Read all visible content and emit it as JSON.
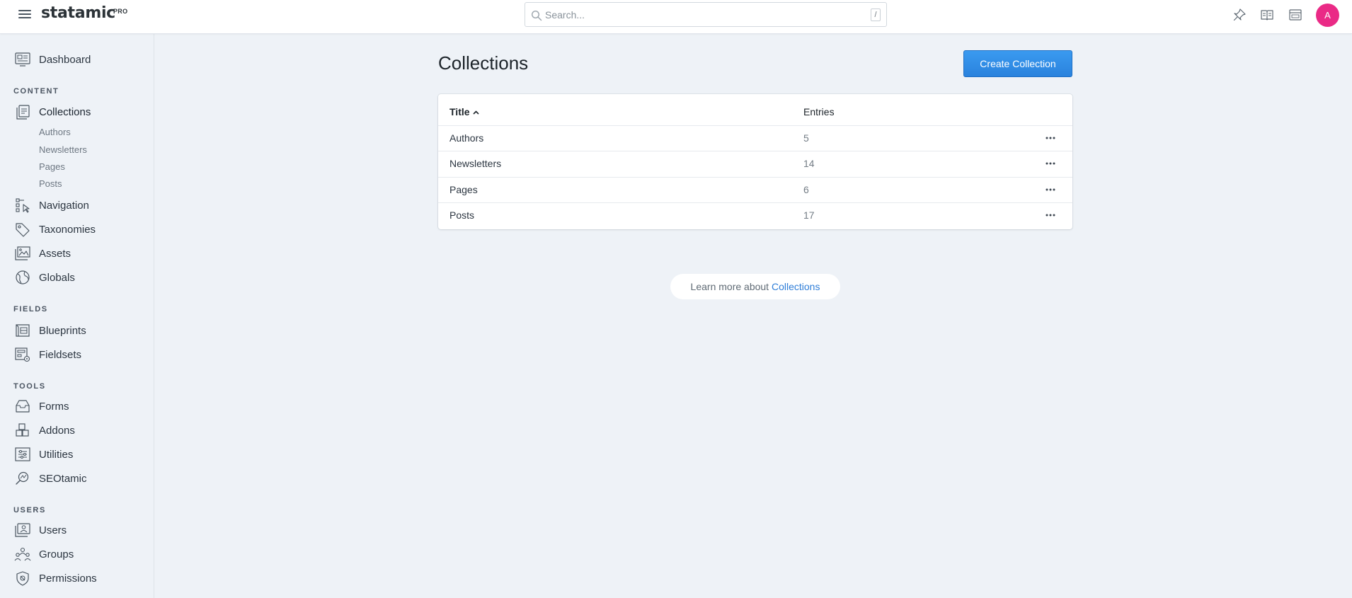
{
  "topbar": {
    "logo": "statamic",
    "logo_badge": "PRO",
    "search_placeholder": "Search...",
    "search_shortcut": "/",
    "avatar_initial": "A",
    "accent": "#ea2a86"
  },
  "sidebar": {
    "dashboard": "Dashboard",
    "sections": {
      "content": "CONTENT",
      "fields": "FIELDS",
      "tools": "TOOLS",
      "users": "USERS"
    },
    "content_items": {
      "collections": "Collections",
      "navigation": "Navigation",
      "taxonomies": "Taxonomies",
      "assets": "Assets",
      "globals": "Globals"
    },
    "collection_children": [
      "Authors",
      "Newsletters",
      "Pages",
      "Posts"
    ],
    "fields_items": {
      "blueprints": "Blueprints",
      "fieldsets": "Fieldsets"
    },
    "tools_items": {
      "forms": "Forms",
      "addons": "Addons",
      "utilities": "Utilities",
      "seotamic": "SEOtamic"
    },
    "users_items": {
      "users": "Users",
      "groups": "Groups",
      "permissions": "Permissions"
    }
  },
  "main": {
    "title": "Collections",
    "create_button": "Create Collection",
    "primary_color": "#2a82dd",
    "table": {
      "columns": {
        "title": "Title",
        "title_sort": "^",
        "entries": "Entries"
      },
      "rows": [
        {
          "title": "Authors",
          "entries": "5"
        },
        {
          "title": "Newsletters",
          "entries": "14"
        },
        {
          "title": "Pages",
          "entries": "6"
        },
        {
          "title": "Posts",
          "entries": "17"
        }
      ]
    },
    "learn_more_prefix": "Learn more about",
    "learn_more_link": "Collections"
  }
}
